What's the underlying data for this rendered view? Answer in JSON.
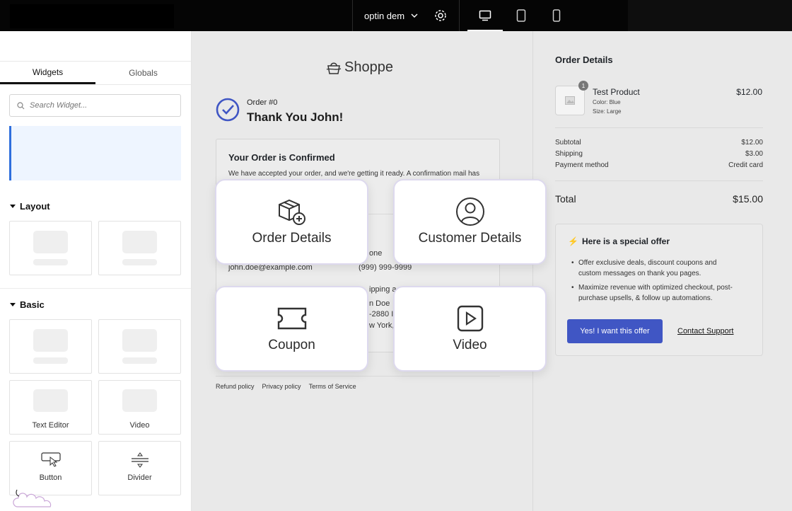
{
  "topbar": {
    "page_name": "optin dem",
    "devices": [
      {
        "icon": "desktop-icon",
        "active": true
      },
      {
        "icon": "tablet-icon",
        "active": false
      },
      {
        "icon": "mobile-icon",
        "active": false
      }
    ]
  },
  "sidebar": {
    "tabs": [
      {
        "label": "Widgets",
        "active": true
      },
      {
        "label": "Globals",
        "active": false
      }
    ],
    "search": {
      "placeholder": "Search Widget..."
    },
    "layout_heading": "Layout",
    "basic_heading": "Basic",
    "widgets": [
      {
        "label": "Text Editor",
        "icon": "text-editor-icon"
      },
      {
        "label": "Video",
        "icon": "video-icon"
      },
      {
        "label": "Button",
        "icon": "button-icon"
      },
      {
        "label": "Divider",
        "icon": "divider-icon"
      }
    ]
  },
  "preview": {
    "brand": "Shoppe",
    "order_number": "Order #0",
    "thanks": "Thank You John!",
    "confirm_title": "Your Order is Confirmed",
    "confirm_text": "We have accepted your order, and we're getting it ready. A confirmation mail has",
    "email": "john.doe@example.com",
    "phone": "(999) 999-9999",
    "phone_partial": "one",
    "shipping_partial": "ipping a",
    "name_partial": "n Doe",
    "addr_partial": "-2880 I",
    "city_partial": "w York,",
    "footer_links": [
      "Refund policy",
      "Privacy policy",
      "Terms of Service"
    ]
  },
  "order_summary": {
    "title": "Order Details",
    "product": {
      "name": "Test Product",
      "qty": "1",
      "color": "Color: Blue",
      "size": "Size: Large",
      "price": "$12.00"
    },
    "subtotal_label": "Subtotal",
    "subtotal": "$12.00",
    "shipping_label": "Shipping",
    "shipping": "$3.00",
    "payment_label": "Payment method",
    "payment": "Credit card",
    "total_label": "Total",
    "total": "$15.00"
  },
  "offer": {
    "title": "Here is a special offer",
    "bullets": [
      "Offer exclusive deals, discount coupons and custom messages on thank you pages.",
      "Maximize revenue with optimized checkout, post-purchase upsells, & follow up automations."
    ],
    "cta": "Yes! I want this offer",
    "support": "Contact Support"
  },
  "overlay_cards": [
    {
      "label": "Order Details",
      "icon": "package-add-icon"
    },
    {
      "label": "Customer Details",
      "icon": "user-circle-icon"
    },
    {
      "label": "Coupon",
      "icon": "ticket-icon"
    },
    {
      "label": "Video",
      "icon": "play-icon"
    }
  ]
}
